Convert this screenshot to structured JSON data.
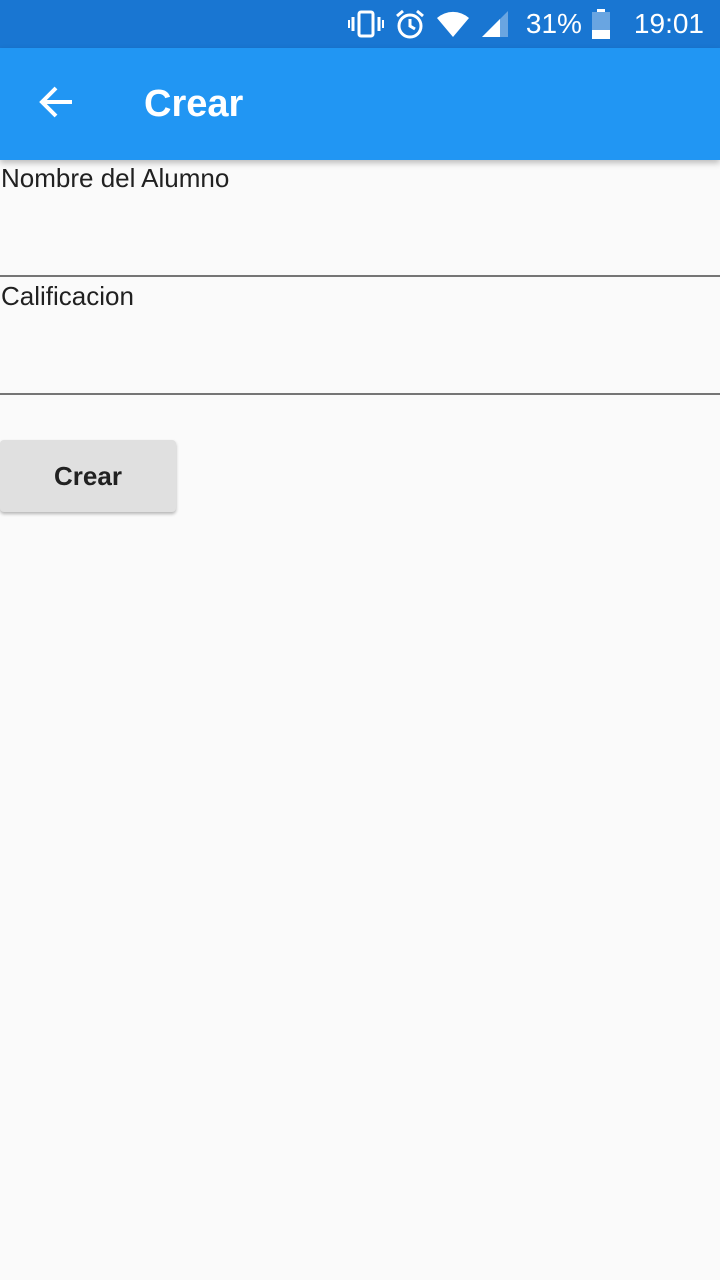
{
  "status_bar": {
    "battery_percent": "31%",
    "time": "19:01",
    "icons": [
      "vibrate-icon",
      "alarm-icon",
      "wifi-icon",
      "signal-icon",
      "battery-icon"
    ]
  },
  "app_bar": {
    "title": "Crear",
    "back_icon": "arrow-back-icon",
    "color": "#2196f3"
  },
  "form": {
    "fields": [
      {
        "label": "Nombre del Alumno",
        "value": ""
      },
      {
        "label": "Calificacion",
        "value": ""
      }
    ],
    "submit_label": "Crear"
  }
}
